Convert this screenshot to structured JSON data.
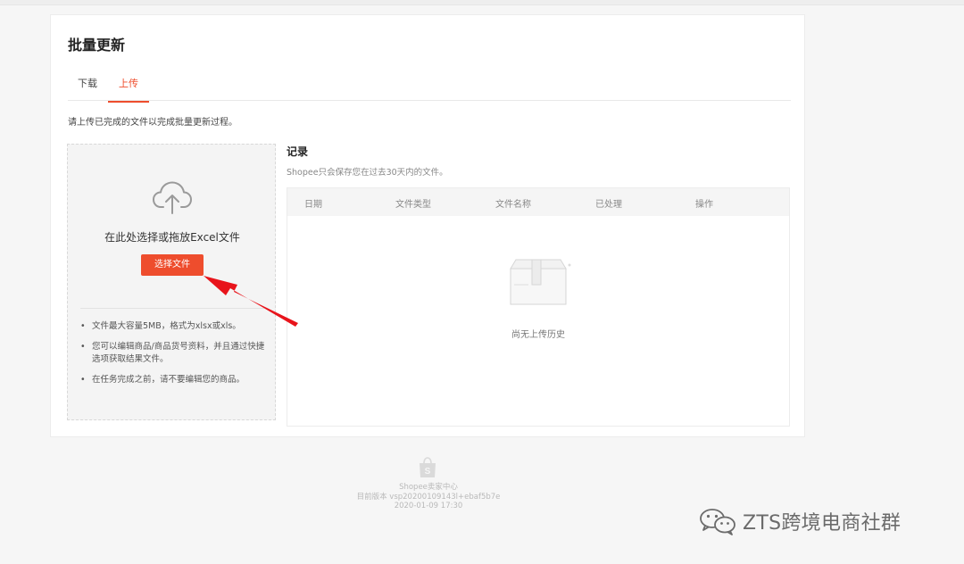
{
  "page": {
    "title": "批量更新",
    "instruction": "请上传已完成的文件以完成批量更新过程。"
  },
  "tabs": [
    {
      "label": "下载",
      "active": false
    },
    {
      "label": "上传",
      "active": true
    }
  ],
  "upload": {
    "prompt": "在此处选择或拖放Excel文件",
    "button_label": "选择文件",
    "notes": [
      "文件最大容量5MB，格式为xlsx或xls。",
      "您可以编辑商品/商品货号资料，并且通过快捷选项获取结果文件。",
      "在任务完成之前，请不要编辑您的商品。"
    ],
    "icon": "cloud-upload-icon"
  },
  "records": {
    "title": "记录",
    "subtitle": "Shopee只会保存您在过去30天内的文件。",
    "columns": [
      "日期",
      "文件类型",
      "文件名称",
      "已处理",
      "操作"
    ],
    "empty_text": "尚无上传历史",
    "empty_icon": "empty-box-icon"
  },
  "footer": {
    "brand": "Shopee卖家中心",
    "version": "目前版本  vsp20200109143l+ebaf5b7e",
    "datetime": "2020-01-09 17:30"
  },
  "watermark": {
    "text": "ZTS跨境电商社群"
  },
  "colors": {
    "accent": "#ee4d2d",
    "arrow": "#e8141b",
    "background": "#f6f6f6"
  }
}
